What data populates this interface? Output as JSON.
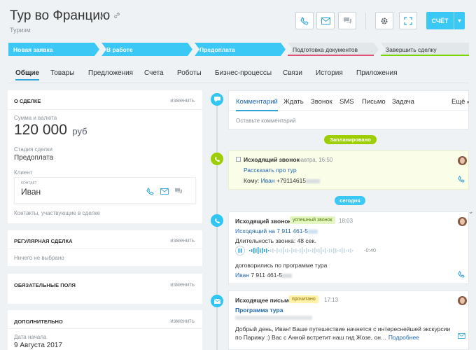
{
  "header": {
    "title": "Тур во Францию",
    "subtitle": "Туризм",
    "account_button": "СЧЁТ"
  },
  "stages": [
    {
      "label": "Новая заявка",
      "state": "active"
    },
    {
      "label": "В работе",
      "state": "active"
    },
    {
      "label": "Предоплата",
      "state": "active"
    },
    {
      "label": "Подготовка документов",
      "state": "idle",
      "accent": "#e0517a"
    },
    {
      "label": "Завершить сделку",
      "state": "idle",
      "accent": "#7bd500"
    }
  ],
  "tabs": [
    "Общие",
    "Товары",
    "Предложения",
    "Счета",
    "Роботы",
    "Бизнес-процессы",
    "Связи",
    "История",
    "Приложения"
  ],
  "about": {
    "header": "О СДЕЛКЕ",
    "edit": "изменить",
    "amount_label": "Сумма и валюта",
    "amount": "120 000",
    "currency": "руб",
    "stage_label": "Стадия сделки",
    "stage_value": "Предоплата",
    "client_label": "Клиент",
    "contact_label": "КОНТАКТ",
    "contact_name": "Иван",
    "participants": "Контакты, участвующие в сделке"
  },
  "regular": {
    "header": "РЕГУЛЯРНАЯ СДЕЛКА",
    "edit": "изменить",
    "value": "Ничего не выбрано"
  },
  "required": {
    "header": "ОБЯЗАТЕЛЬНЫЕ ПОЛЯ",
    "edit": "изменить"
  },
  "extra": {
    "header": "ДОПОЛНИТЕЛЬНО",
    "edit": "изменить",
    "date_label": "Дата начала",
    "date_value": "9 Августа 2017"
  },
  "comment_tabs": [
    "Комментарий",
    "Ждать",
    "Звонок",
    "SMS",
    "Письмо",
    "Задача"
  ],
  "more_label": "Ещё",
  "comment_placeholder": "Оставьте комментарий",
  "planned_label": "Запланировано",
  "today_label": "сегодня",
  "planned_call": {
    "title": "Исходящий звонок",
    "when": "завтра, 16:50",
    "subject": "Рассказать про тур",
    "to_label": "Кому:",
    "to_name": "Иван",
    "to_phone": "+79114615"
  },
  "done_call": {
    "title": "Исходящий звонок",
    "badge": "успешный звонок",
    "time": "18:03",
    "link": "Исходящий на 7 911 461-5",
    "duration": "Длительность звонка: 48 сек.",
    "audio_time": "-0:40",
    "note": "договорились по программе тура",
    "contact_name": "Иван",
    "contact_phone": "7 911 461-5"
  },
  "email": {
    "title": "Исходящее письмо",
    "badge": "прочитано",
    "time": "17:13",
    "subject": "Программа тура",
    "body": "Добрый день, Иван! Ваше путешествие начнется с интереснейшей экскурсии по Парижу :) Вас с Анной встретит наш гид Жозе, он…",
    "more": "Подробнее"
  },
  "colors": {
    "accent": "#3bc8f5",
    "link": "#2067b0",
    "planned": "#9dcf00",
    "success_badge": "#e5f6c3",
    "read_badge": "#fff1a8",
    "call_icon": "#2fc6f6"
  }
}
